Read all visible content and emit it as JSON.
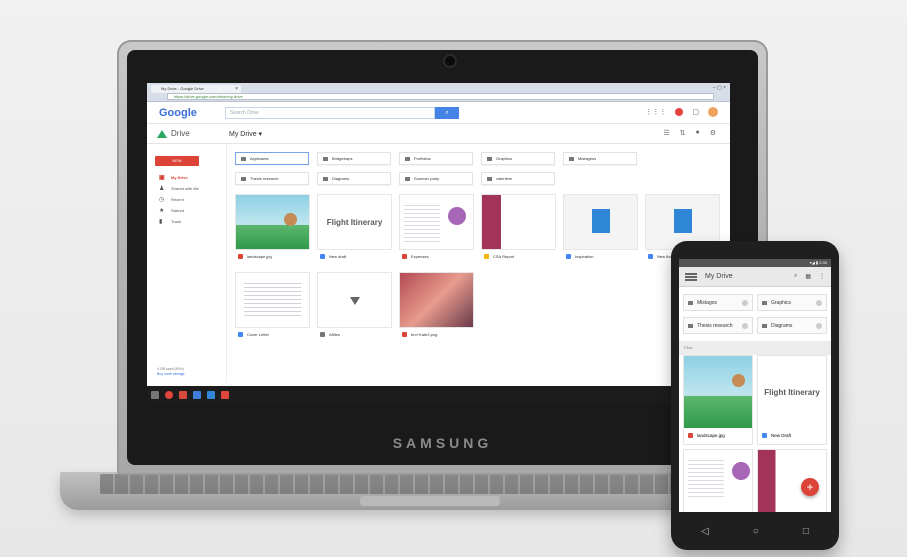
{
  "browser": {
    "tab_title": "My Drive - Google Drive",
    "url": "https://drive.google.com/drive/my-drive",
    "window_controls": "– ▢ ×"
  },
  "google": {
    "logo": "Google",
    "search_placeholder": "Search Drive",
    "search_icon": "search-icon"
  },
  "drive": {
    "app_name": "Drive",
    "location": "My Drive ▾",
    "toolbar_icons": [
      "grid-icon",
      "sort-icon",
      "info-icon",
      "gear-icon"
    ]
  },
  "sidebar": {
    "new_label": "NEW",
    "items": [
      {
        "label": "My Drive",
        "icon": "folder-icon"
      },
      {
        "label": "Shared with Me",
        "icon": "people-icon"
      },
      {
        "label": "Recent",
        "icon": "clock-icon"
      },
      {
        "label": "Starred",
        "icon": "star-icon"
      },
      {
        "label": "Trash",
        "icon": "trash-icon"
      }
    ],
    "storage_used": "4 GB used (50%)",
    "storage_upgrade": "Buy more storage"
  },
  "folders": [
    "Applicants",
    "Bridgetraps",
    "Portfolios",
    "Graphics",
    "Mistagens",
    "Thesis research",
    "Diagrams",
    "Summer party",
    "valentine"
  ],
  "files": [
    {
      "name": "landscape.jpg",
      "color": "#db4437"
    },
    {
      "name": "New draft",
      "color": "#4285f4"
    },
    {
      "name": "Expenses",
      "color": "#db4437"
    },
    {
      "name": "CSA Report",
      "color": "#f4b400"
    },
    {
      "name": "Inspiration",
      "color": "#4285f4"
    },
    {
      "name": "New floorp",
      "color": "#4285f4"
    },
    {
      "name": "Cover Letter",
      "color": "#4285f4"
    },
    {
      "name": "Affiles",
      "color": "#777777"
    },
    {
      "name": "bro+Kate2.png",
      "color": "#db4437"
    }
  ],
  "thumb_text": {
    "flight": "Flight Itinerary"
  },
  "laptop": {
    "brand": "SAMSUNG"
  },
  "phone": {
    "status": "▾◢ ▮ 2:30",
    "title": "My Drive",
    "folders": [
      "Mistagos",
      "Graphics",
      "Thesis research",
      "Diagrams"
    ],
    "files_label": "Files",
    "files": [
      {
        "name": "landscape.jpg",
        "color": "#db4437"
      },
      {
        "name": "New Draft",
        "color": "#4285f4"
      }
    ],
    "flight": "Flight Itinerary",
    "fab": "+",
    "nav": [
      "◁",
      "○",
      "□"
    ]
  }
}
